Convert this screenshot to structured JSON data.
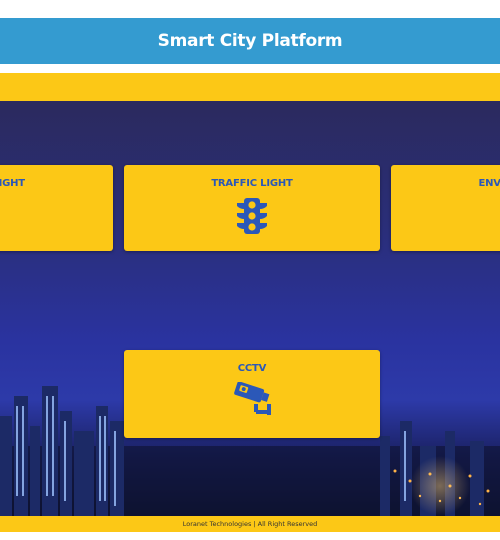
{
  "header": {
    "title": "Smart City Platform"
  },
  "cards": [
    {
      "label": "STREET LIGHT",
      "icon": "street-light-icon"
    },
    {
      "label": "TRAFFIC LIGHT",
      "icon": "traffic-light-icon"
    },
    {
      "label": "ENVIRONMENT",
      "icon": "environment-icon"
    },
    {
      "label": "CCTV",
      "icon": "cctv-camera-icon"
    }
  ],
  "footer": {
    "text": "Loranet Technologies | All Right Reserved"
  },
  "colors": {
    "header_bg": "#349bd0",
    "accent_yellow": "#fcc816",
    "icon_blue": "#2b58b8",
    "hero_dark": "#2a2e78"
  }
}
